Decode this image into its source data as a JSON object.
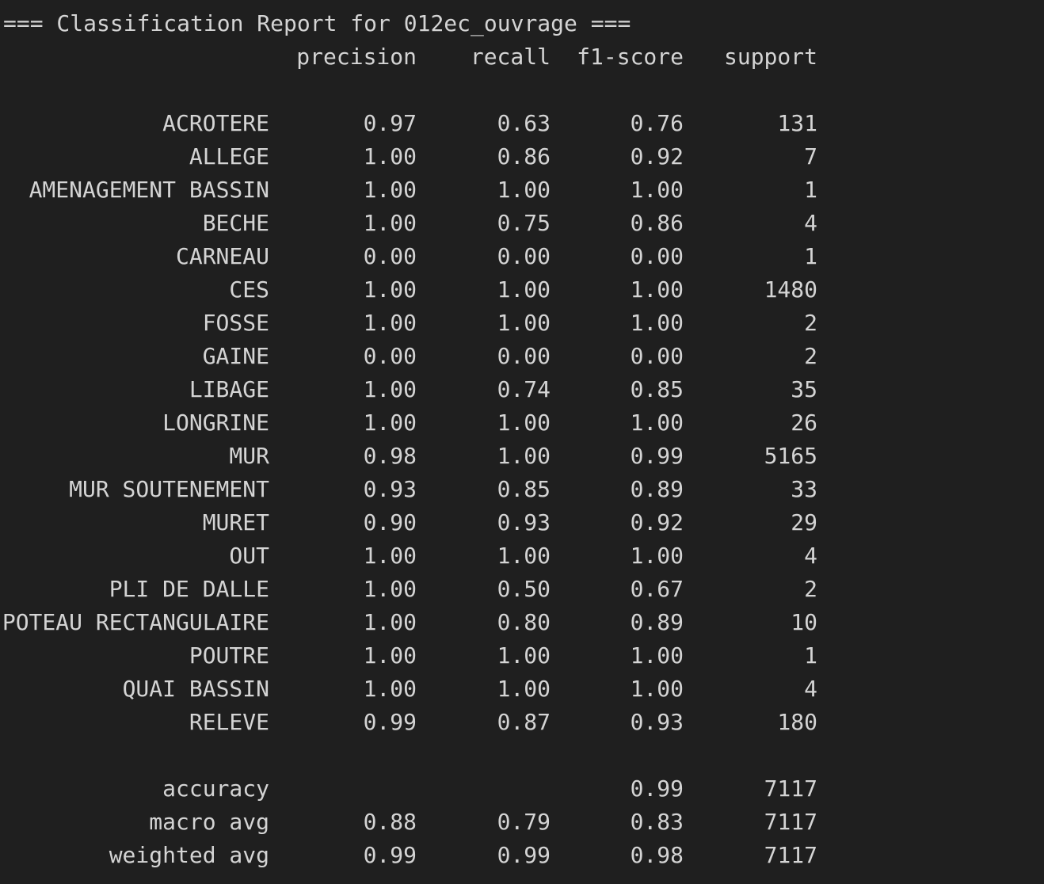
{
  "report": {
    "title": "=== Classification Report for 012ec_ouvrage ===",
    "headers": {
      "precision": "precision",
      "recall": "recall",
      "f1": "f1-score",
      "support": "support"
    },
    "rows": [
      {
        "label": "ACROTERE",
        "precision": "0.97",
        "recall": "0.63",
        "f1": "0.76",
        "support": "131"
      },
      {
        "label": "ALLEGE",
        "precision": "1.00",
        "recall": "0.86",
        "f1": "0.92",
        "support": "7"
      },
      {
        "label": "AMENAGEMENT BASSIN",
        "precision": "1.00",
        "recall": "1.00",
        "f1": "1.00",
        "support": "1"
      },
      {
        "label": "BECHE",
        "precision": "1.00",
        "recall": "0.75",
        "f1": "0.86",
        "support": "4"
      },
      {
        "label": "CARNEAU",
        "precision": "0.00",
        "recall": "0.00",
        "f1": "0.00",
        "support": "1"
      },
      {
        "label": "CES",
        "precision": "1.00",
        "recall": "1.00",
        "f1": "1.00",
        "support": "1480"
      },
      {
        "label": "FOSSE",
        "precision": "1.00",
        "recall": "1.00",
        "f1": "1.00",
        "support": "2"
      },
      {
        "label": "GAINE",
        "precision": "0.00",
        "recall": "0.00",
        "f1": "0.00",
        "support": "2"
      },
      {
        "label": "LIBAGE",
        "precision": "1.00",
        "recall": "0.74",
        "f1": "0.85",
        "support": "35"
      },
      {
        "label": "LONGRINE",
        "precision": "1.00",
        "recall": "1.00",
        "f1": "1.00",
        "support": "26"
      },
      {
        "label": "MUR",
        "precision": "0.98",
        "recall": "1.00",
        "f1": "0.99",
        "support": "5165"
      },
      {
        "label": "MUR SOUTENEMENT",
        "precision": "0.93",
        "recall": "0.85",
        "f1": "0.89",
        "support": "33"
      },
      {
        "label": "MURET",
        "precision": "0.90",
        "recall": "0.93",
        "f1": "0.92",
        "support": "29"
      },
      {
        "label": "OUT",
        "precision": "1.00",
        "recall": "1.00",
        "f1": "1.00",
        "support": "4"
      },
      {
        "label": "PLI DE DALLE",
        "precision": "1.00",
        "recall": "0.50",
        "f1": "0.67",
        "support": "2"
      },
      {
        "label": "POTEAU RECTANGULAIRE",
        "precision": "1.00",
        "recall": "0.80",
        "f1": "0.89",
        "support": "10"
      },
      {
        "label": "POUTRE",
        "precision": "1.00",
        "recall": "1.00",
        "f1": "1.00",
        "support": "1"
      },
      {
        "label": "QUAI BASSIN",
        "precision": "1.00",
        "recall": "1.00",
        "f1": "1.00",
        "support": "4"
      },
      {
        "label": "RELEVE",
        "precision": "0.99",
        "recall": "0.87",
        "f1": "0.93",
        "support": "180"
      }
    ],
    "summary": [
      {
        "label": "accuracy",
        "precision": "",
        "recall": "",
        "f1": "0.99",
        "support": "7117"
      },
      {
        "label": "macro avg",
        "precision": "0.88",
        "recall": "0.79",
        "f1": "0.83",
        "support": "7117"
      },
      {
        "label": "weighted avg",
        "precision": "0.99",
        "recall": "0.99",
        "f1": "0.98",
        "support": "7117"
      }
    ]
  },
  "colors": {
    "background": "#1f1f1f",
    "text": "#d4d4d4"
  }
}
